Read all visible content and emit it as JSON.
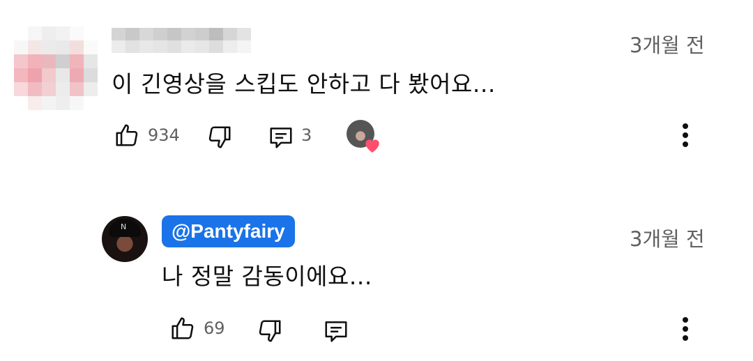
{
  "comment": {
    "avatar_icon": "blurred-avatar",
    "username": "",
    "time": "3개월 전",
    "text": "이 긴영상을 스킵도 안하고 다 봤어요...",
    "likes": "934",
    "replies": "3",
    "creator_heart": "heart-icon"
  },
  "reply": {
    "mention": "@Pantyfairy",
    "time": "3개월 전",
    "text": "나 정말 감동이에요...",
    "likes": "69"
  },
  "colors": {
    "mention_bg": "#1a73e8",
    "heart": "#ff4e6e",
    "meta_text": "#606060"
  }
}
